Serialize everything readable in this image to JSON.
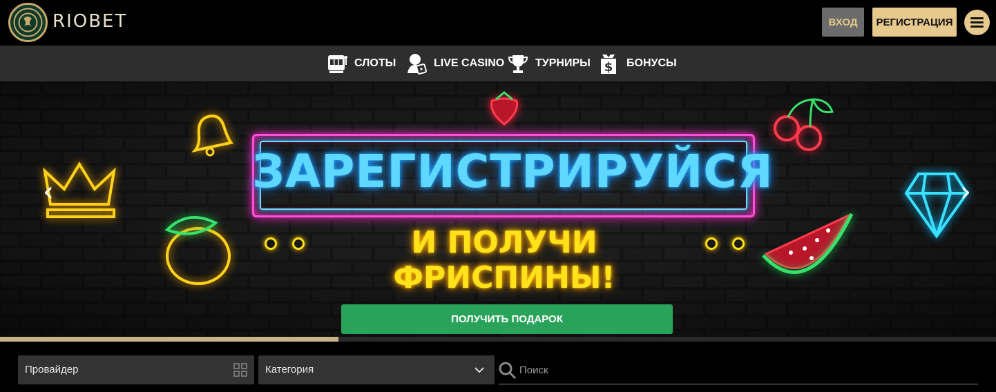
{
  "header": {
    "brand": "RIOBET",
    "login_label": "ВХОД",
    "register_label": "РЕГИСТРАЦИЯ",
    "accent_color": "#e7c98e"
  },
  "nav": {
    "items": [
      {
        "label": "СЛОТЫ",
        "icon": "slot-machine-icon"
      },
      {
        "label": "LIVE CASINO",
        "icon": "dealer-icon"
      },
      {
        "label": "ТУРНИРЫ",
        "icon": "trophy-icon"
      },
      {
        "label": "БОНУСЫ",
        "icon": "dollar-bag-icon"
      }
    ]
  },
  "banner": {
    "title": "ЗАРЕГИСТРИРУЙСЯ",
    "subtitle": "И ПОЛУЧИ ФРИСПИНЫ!",
    "cta_label": "ПОЛУЧИТЬ ПОДАРОК",
    "cta_color": "#2aa35a",
    "slide_progress": 0.34,
    "prev_icon": "chevron-left-icon",
    "next_icon": "chevron-right-icon"
  },
  "filters": {
    "provider_label": "Провайдер",
    "category_label": "Категория",
    "search_placeholder": "Поиск"
  }
}
